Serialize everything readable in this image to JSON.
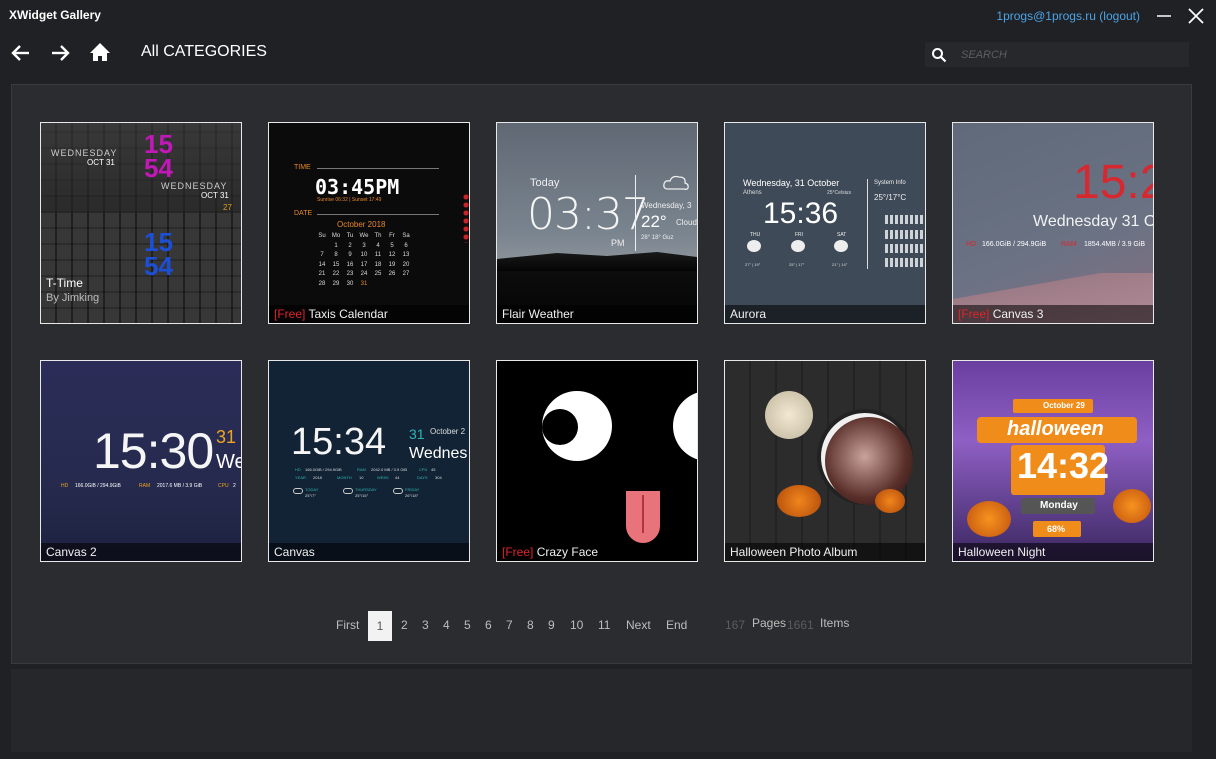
{
  "app": {
    "title": "XWidget Gallery",
    "user_link": "1progs@1progs.ru (logout)"
  },
  "nav": {
    "breadcrumb": "All CATEGORIES"
  },
  "search": {
    "placeholder": "SEARCH"
  },
  "widgets": [
    {
      "name": "T-Time",
      "author": "By Jimking",
      "free": ""
    },
    {
      "name": "Taxis Calendar",
      "free": "[Free]"
    },
    {
      "name": "Flair Weather",
      "free": ""
    },
    {
      "name": "Aurora",
      "free": ""
    },
    {
      "name": "Canvas 3",
      "free": "[Free]"
    },
    {
      "name": "Canvas 2",
      "free": ""
    },
    {
      "name": "Canvas",
      "free": ""
    },
    {
      "name": "Crazy Face",
      "free": "[Free]"
    },
    {
      "name": "Halloween Photo Album",
      "free": ""
    },
    {
      "name": "Halloween Night",
      "free": ""
    }
  ],
  "thumbs": {
    "ttime": {
      "day1": "WEDNESDAY",
      "date1": "OCT  31",
      "hour1": "15",
      "min1": "54",
      "day2": "WEDNESDAY",
      "date2": "OCT  31",
      "num": "27",
      "hour2": "15",
      "min2": "54"
    },
    "taxis": {
      "time_label": "TIME",
      "time": "03:45PM",
      "sun": "Sunrise 06:32 | Sunset 17:49",
      "date_label": "DATE",
      "month": "October 2018",
      "days": [
        "Su",
        "Mo",
        "Tu",
        "We",
        "Th",
        "Fr",
        "Sa"
      ],
      "rows": [
        [
          "",
          "1",
          "2",
          "3",
          "4",
          "5",
          "6"
        ],
        [
          "7",
          "8",
          "9",
          "10",
          "11",
          "12",
          "13"
        ],
        [
          "14",
          "15",
          "16",
          "17",
          "18",
          "19",
          "20"
        ],
        [
          "21",
          "22",
          "23",
          "24",
          "25",
          "26",
          "27"
        ],
        [
          "28",
          "29",
          "30",
          "31",
          "",
          "",
          ""
        ]
      ]
    },
    "flair": {
      "today": "Today",
      "time": "03:37",
      "ampm": "PM",
      "date": "Wednesday, 3",
      "temp": "22°",
      "cond": "Cloud",
      "hilo": "28° 18°  Guz"
    },
    "aurora": {
      "date": "Wednesday, 31 October",
      "city": "Athens",
      "temp_small": "25°Celsius",
      "time": "15:36",
      "sys": "System Info",
      "sys_temp": "25°/17°C",
      "d1": "THU",
      "d2": "FRI",
      "d3": "SAT",
      "r1": "27° | 19°",
      "r2": "25° | 17°",
      "r3": "21° | 14°"
    },
    "canvas3": {
      "time": "15:2",
      "date": "Wednesday 31 O",
      "hd_label": "HD",
      "hd_val": "166.0GiB / 294.9GiB",
      "ram_label": "RAM",
      "ram_val": "1854.4MB / 3.9 GiB"
    },
    "canvas2": {
      "time": "15:30",
      "day": "31",
      "wd": "We",
      "hd_label": "HD",
      "hd_val": "166.0GiB / 294.9GiB",
      "ram_label": "RAM",
      "ram_val": "2017.6 MB / 3.9 GiB",
      "cpu_label": "CPU",
      "cpu_val": "2"
    },
    "canvas": {
      "time": "15:34",
      "day": "31",
      "month": "October 2",
      "wd": "Wednes",
      "hd_label": "HD",
      "hd_val": "166.0GiB / 294.9GiB",
      "ram_label": "RAM",
      "ram_val": "2042.0 MB / 3.9 GiB",
      "cpu_label": "CPU",
      "cpu_val": "45",
      "year_label": "YEAR",
      "year_val": "2018",
      "month_label": "MONTH",
      "month_val": "10",
      "week_label": "WEEK",
      "week_val": "44",
      "days_label": "DAYS",
      "days_val": "304",
      "f1": "TODAY",
      "f1t": "25°/7°",
      "f2": "THURSDAY",
      "f2t": "25°/16°",
      "f3": "FRIDAY",
      "f3t": "26°/18°"
    },
    "halloween": {
      "date": "October 29",
      "title": "halloween",
      "time": "14:32",
      "day": "Monday",
      "pct": "68%"
    }
  },
  "pagination": {
    "first": "First",
    "pages": [
      "1",
      "2",
      "3",
      "4",
      "5",
      "6",
      "7",
      "8",
      "9",
      "10",
      "11"
    ],
    "next": "Next",
    "end": "End",
    "page_count": "167",
    "pages_label": "Pages",
    "item_count": "1661",
    "items_label": "Items"
  }
}
